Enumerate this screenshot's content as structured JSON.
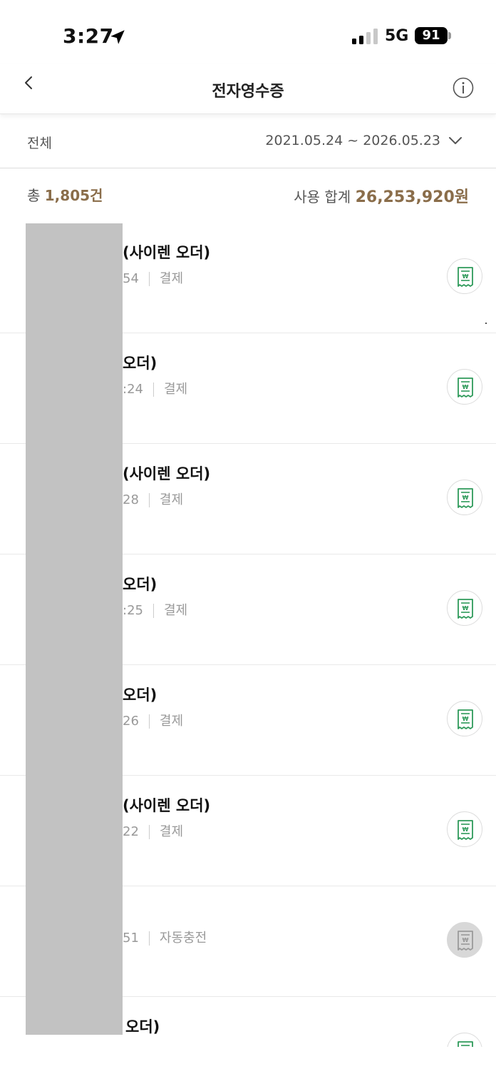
{
  "status_bar": {
    "time": "3:27",
    "network": "5G",
    "battery": "91",
    "icons": [
      "location-arrow-icon",
      "signal-bars-icon",
      "battery-icon"
    ]
  },
  "header": {
    "title": "전자영수증",
    "back_icon": "chevron-left-icon",
    "info_icon": "info-circle-icon"
  },
  "filter": {
    "label": "전체",
    "date_range": "2021.05.24 ~ 2026.05.23",
    "dropdown_icon": "chevron-down-icon"
  },
  "summary": {
    "count_prefix": "총 ",
    "count_value": "1,805건",
    "amount_prefix": "사용 합계 ",
    "amount_value": "26,253,920원"
  },
  "colors": {
    "accent_brown": "#8a6d4a",
    "receipt_green": "#2e9a5a",
    "receipt_disabled": "#d8d8d8"
  },
  "receipts": [
    {
      "title": "(사이렌 오더)",
      "time_fragment": "54",
      "type": "결제",
      "enabled": true
    },
    {
      "title": "오더)",
      "time_fragment": ":24",
      "type": "결제",
      "enabled": true
    },
    {
      "title": "(사이렌 오더)",
      "time_fragment": "28",
      "type": "결제",
      "enabled": true
    },
    {
      "title": "오더)",
      "time_fragment": ":25",
      "type": "결제",
      "enabled": true
    },
    {
      "title": "오더)",
      "time_fragment": "26",
      "type": "결제",
      "enabled": true
    },
    {
      "title": "(사이렌 오더)",
      "time_fragment": "22",
      "type": "결제",
      "enabled": true
    },
    {
      "title": "",
      "time_fragment": "51",
      "type": "자동충전",
      "enabled": false
    },
    {
      "title": "오더)",
      "time_fragment": "",
      "type": "",
      "enabled": true
    }
  ]
}
